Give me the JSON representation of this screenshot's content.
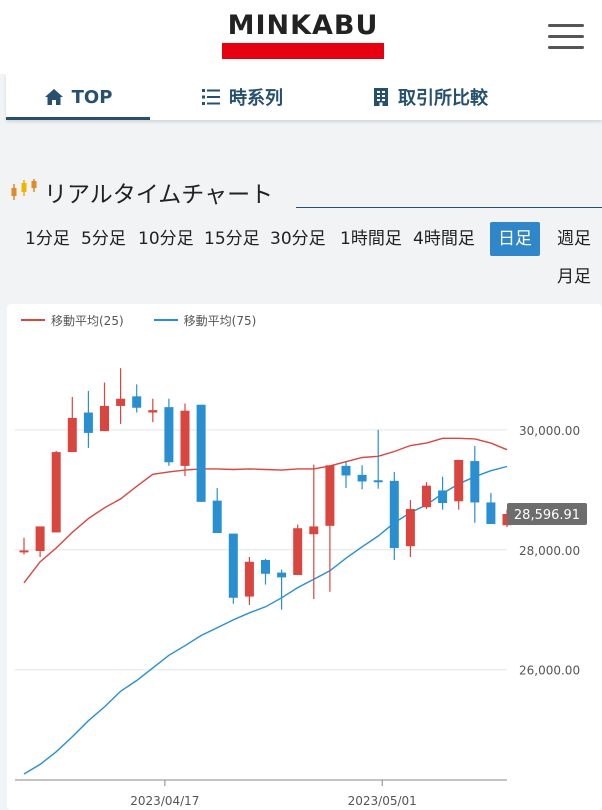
{
  "header": {
    "logo_text": "MINKABU",
    "brand_color": "#e50012"
  },
  "tabs": [
    {
      "label": "TOP",
      "icon": "home-icon",
      "active": true
    },
    {
      "label": "時系列",
      "icon": "list-icon",
      "active": false
    },
    {
      "label": "取引所比較",
      "icon": "building-icon",
      "active": false
    }
  ],
  "section": {
    "title": "リアルタイムチャート",
    "icon": "candlestick-icon"
  },
  "periods": [
    {
      "label": "1分足",
      "active": false
    },
    {
      "label": "5分足",
      "active": false
    },
    {
      "label": "10分足",
      "active": false
    },
    {
      "label": "15分足",
      "active": false
    },
    {
      "label": "30分足",
      "active": false
    },
    {
      "label": "1時間足",
      "active": false
    },
    {
      "label": "4時間足",
      "active": false
    },
    {
      "label": "日足",
      "active": true
    },
    {
      "label": "週足",
      "active": false
    },
    {
      "label": "月足",
      "active": false
    }
  ],
  "chart_data": {
    "type": "candlestick",
    "legend": [
      {
        "name": "移動平均(25)",
        "color": "#d9453f"
      },
      {
        "name": "移動平均(75)",
        "color": "#2a8fd1"
      }
    ],
    "up_color": "#d9453f",
    "down_color": "#2a8fd1",
    "y_ticks": [
      26000,
      28000,
      30000
    ],
    "y_tick_labels": [
      "26,000.00",
      "28,000.00",
      "30,000.00"
    ],
    "x_ticks": [
      {
        "date": "2023/04/17",
        "index": 8.75
      },
      {
        "date": "2023/05/01",
        "index": 22.25
      }
    ],
    "current_price": 28596.91,
    "current_price_label": "28,596.91",
    "ylim": [
      24160,
      31600
    ],
    "candles": [
      {
        "o": 27970,
        "h": 28200,
        "l": 27920,
        "c": 27990
      },
      {
        "o": 27980,
        "h": 28380,
        "l": 27880,
        "c": 28390
      },
      {
        "o": 28290,
        "h": 29650,
        "l": 28290,
        "c": 29630
      },
      {
        "o": 29630,
        "h": 30550,
        "l": 29630,
        "c": 30200
      },
      {
        "o": 30290,
        "h": 30650,
        "l": 29700,
        "c": 29950
      },
      {
        "o": 29980,
        "h": 30790,
        "l": 29980,
        "c": 30400
      },
      {
        "o": 30400,
        "h": 31030,
        "l": 30100,
        "c": 30520
      },
      {
        "o": 30560,
        "h": 30760,
        "l": 30290,
        "c": 30370
      },
      {
        "o": 30290,
        "h": 30520,
        "l": 30130,
        "c": 30330
      },
      {
        "o": 30380,
        "h": 30520,
        "l": 29400,
        "c": 29460
      },
      {
        "o": 29400,
        "h": 30440,
        "l": 29230,
        "c": 30320
      },
      {
        "o": 30420,
        "h": 30420,
        "l": 28800,
        "c": 28800
      },
      {
        "o": 28820,
        "h": 29030,
        "l": 28280,
        "c": 28280
      },
      {
        "o": 28270,
        "h": 28270,
        "l": 27100,
        "c": 27200
      },
      {
        "o": 27220,
        "h": 27880,
        "l": 27080,
        "c": 27800
      },
      {
        "o": 27830,
        "h": 27850,
        "l": 27420,
        "c": 27600
      },
      {
        "o": 27620,
        "h": 27670,
        "l": 27000,
        "c": 27540
      },
      {
        "o": 27580,
        "h": 28420,
        "l": 27580,
        "c": 28360
      },
      {
        "o": 28260,
        "h": 29420,
        "l": 27180,
        "c": 28390
      },
      {
        "o": 28400,
        "h": 29340,
        "l": 27300,
        "c": 29410
      },
      {
        "o": 29400,
        "h": 29470,
        "l": 29030,
        "c": 29240
      },
      {
        "o": 29250,
        "h": 29410,
        "l": 29010,
        "c": 29140
      },
      {
        "o": 29160,
        "h": 30000,
        "l": 29020,
        "c": 29150
      },
      {
        "o": 29150,
        "h": 29300,
        "l": 27830,
        "c": 28030
      },
      {
        "o": 28060,
        "h": 28830,
        "l": 27880,
        "c": 28680
      },
      {
        "o": 28710,
        "h": 29130,
        "l": 28680,
        "c": 29070
      },
      {
        "o": 28990,
        "h": 29220,
        "l": 28670,
        "c": 28780
      },
      {
        "o": 28810,
        "h": 29400,
        "l": 28670,
        "c": 29500
      },
      {
        "o": 29480,
        "h": 29730,
        "l": 28450,
        "c": 28790
      },
      {
        "o": 28790,
        "h": 28950,
        "l": 28480,
        "c": 28430
      },
      {
        "o": 28410,
        "h": 28670,
        "l": 28380,
        "c": 28597
      }
    ],
    "ma25": [
      27450,
      27800,
      28030,
      28290,
      28520,
      28700,
      28850,
      29060,
      29260,
      29300,
      29330,
      29350,
      29350,
      29340,
      29350,
      29340,
      29330,
      29350,
      29350,
      29400,
      29470,
      29540,
      29560,
      29640,
      29740,
      29780,
      29860,
      29860,
      29850,
      29780,
      29670
    ],
    "ma75": [
      24260,
      24420,
      24630,
      24880,
      25150,
      25380,
      25640,
      25820,
      26030,
      26240,
      26400,
      26570,
      26700,
      26830,
      26950,
      27050,
      27200,
      27370,
      27510,
      27650,
      27860,
      28050,
      28230,
      28450,
      28620,
      28750,
      28940,
      29100,
      29220,
      29320,
      29390
    ]
  }
}
